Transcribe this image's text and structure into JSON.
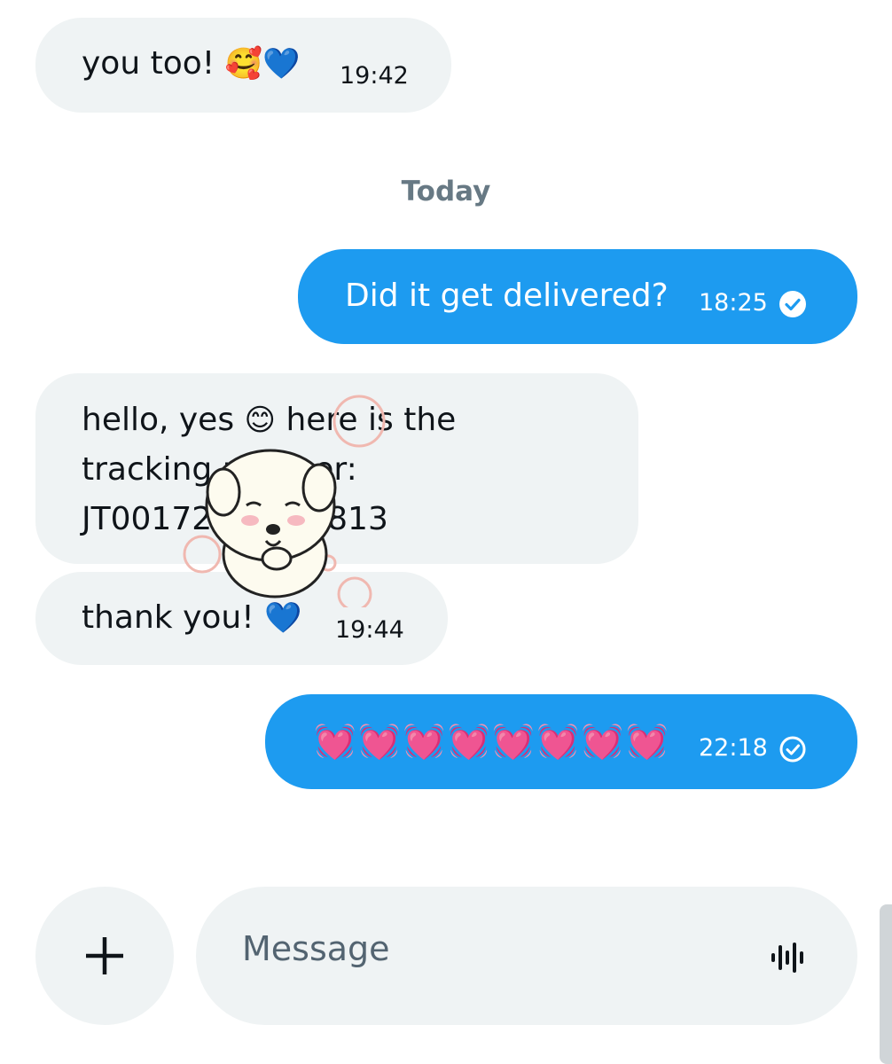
{
  "messages": [
    {
      "direction": "incoming",
      "text": "you too!",
      "emoji": "🥰",
      "heart": "💙",
      "time": "19:42"
    },
    {
      "direction": "outgoing",
      "text": "Did it get delivered?",
      "time": "18:25",
      "status": "sent"
    },
    {
      "direction": "incoming",
      "line1": "hello, yes",
      "emoji": "😊",
      "line1_rest": "here is the",
      "line2": "tracking number:",
      "line3": "JT00172",
      "line3_end": "813"
    },
    {
      "direction": "incoming",
      "text": "thank you!",
      "heart": "💙",
      "time": "19:44"
    },
    {
      "direction": "outgoing",
      "hearts": "💓💓💓💓💓💓💓💓",
      "time": "22:18",
      "status": "sent"
    }
  ],
  "day_separator": "Today",
  "composer": {
    "placeholder": "Message",
    "add_icon": "plus-icon",
    "voice_icon": "voice-waveform-icon"
  },
  "colors": {
    "outgoing_bubble": "#1d9bf0",
    "incoming_bubble": "#eff3f4",
    "separator_text": "#677984"
  },
  "sticker": {
    "icon": "puppy-sticker"
  }
}
